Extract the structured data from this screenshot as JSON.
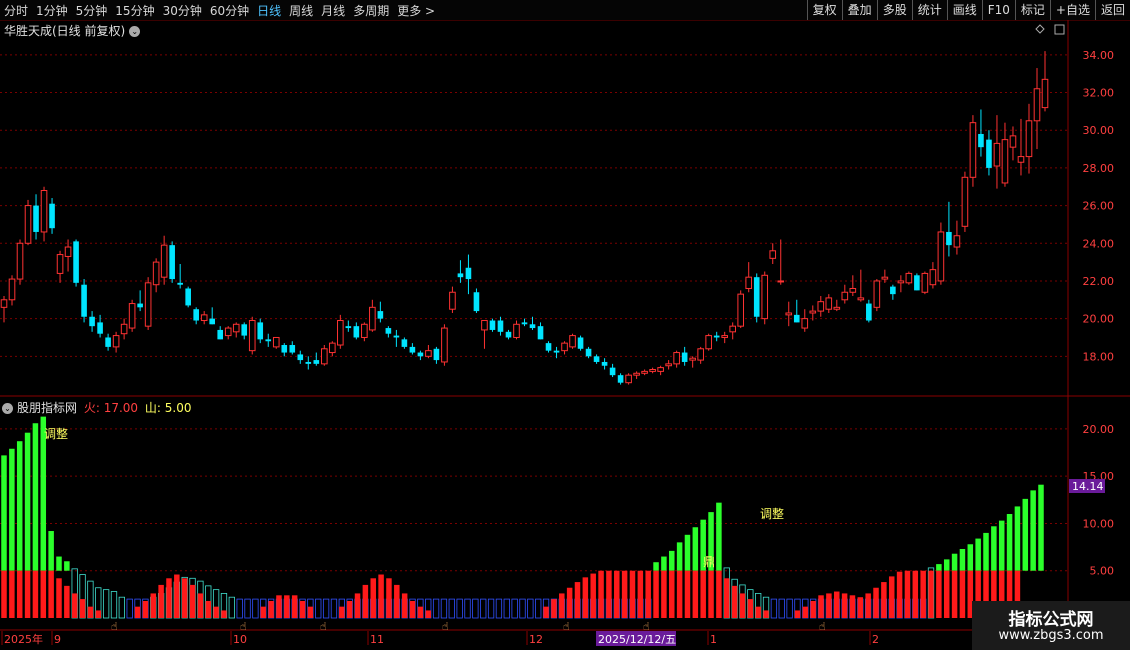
{
  "toolbar": {
    "periods": [
      "分时",
      "1分钟",
      "5分钟",
      "15分钟",
      "30分钟",
      "60分钟",
      "日线",
      "周线",
      "月线",
      "多周期",
      "更多 >"
    ],
    "active_period": "日线",
    "right_buttons": [
      "复权",
      "叠加",
      "多股",
      "统计",
      "画线",
      "F10",
      "标记",
      "+自选",
      "返回"
    ]
  },
  "main_title": "华胜天成(日线 前复权)",
  "indicator": {
    "name": "股朋指标网",
    "fire_label": "火: 17.00",
    "mountain_label": "山: 5.00",
    "current_value": "14.14",
    "annotations": [
      "调整",
      "调整",
      "鼎"
    ]
  },
  "price_axis_labels": [
    "34.00",
    "32.00",
    "30.00",
    "28.00",
    "26.00",
    "24.00",
    "22.00",
    "20.00",
    "18.00"
  ],
  "indicator_axis_labels": [
    "20.00",
    "15.00",
    "10.00",
    "5.00"
  ],
  "date_axis": {
    "labels": [
      "2025年",
      "9",
      "10",
      "11",
      "12",
      "2025/12/12/五",
      "1",
      "2"
    ]
  },
  "colors": {
    "up": "#ff3232",
    "down": "#00e5ff",
    "green_bar": "#2bff2b",
    "red_bar": "#ff1a1a",
    "grid": "#7a0000",
    "axis_text": "#ff4040",
    "highlight": "#6a1b9a"
  },
  "watermark": {
    "line1": "指标公式网",
    "line2": "www.zbgs3.com"
  },
  "chart_data": {
    "type": "candlestick",
    "title": "华胜天成(日线 前复权)",
    "ylim": [
      16.0,
      35.0
    ],
    "candles": [
      [
        20.6,
        21.2,
        19.8,
        21.0
      ],
      [
        21.0,
        22.3,
        20.7,
        22.1
      ],
      [
        22.1,
        24.2,
        21.8,
        24.0
      ],
      [
        24.0,
        26.3,
        23.9,
        26.0
      ],
      [
        26.0,
        26.6,
        24.2,
        24.6
      ],
      [
        24.6,
        27.0,
        24.1,
        26.8
      ],
      [
        26.1,
        26.4,
        24.5,
        24.8
      ],
      [
        22.4,
        23.6,
        21.9,
        23.4
      ],
      [
        23.3,
        24.2,
        22.5,
        23.8
      ],
      [
        24.1,
        24.2,
        21.7,
        21.9
      ],
      [
        21.8,
        22.1,
        19.8,
        20.1
      ],
      [
        20.1,
        20.4,
        19.3,
        19.6
      ],
      [
        19.8,
        20.2,
        19.0,
        19.2
      ],
      [
        19.0,
        19.2,
        18.3,
        18.5
      ],
      [
        18.5,
        19.3,
        18.2,
        19.1
      ],
      [
        19.2,
        20.0,
        18.9,
        19.7
      ],
      [
        19.5,
        21.0,
        19.3,
        20.8
      ],
      [
        20.8,
        21.5,
        20.4,
        20.6
      ],
      [
        19.6,
        22.2,
        19.4,
        21.9
      ],
      [
        21.8,
        23.2,
        21.4,
        23.0
      ],
      [
        22.2,
        24.4,
        21.8,
        23.9
      ],
      [
        23.9,
        24.1,
        21.9,
        22.1
      ],
      [
        21.9,
        22.9,
        21.6,
        21.8
      ],
      [
        21.6,
        21.7,
        20.6,
        20.7
      ],
      [
        20.5,
        20.6,
        19.7,
        19.9
      ],
      [
        19.9,
        20.4,
        19.7,
        20.2
      ],
      [
        20.0,
        20.6,
        19.7,
        19.7
      ],
      [
        19.4,
        19.6,
        18.9,
        18.9
      ],
      [
        19.1,
        19.6,
        18.9,
        19.5
      ],
      [
        19.3,
        19.8,
        19.0,
        19.7
      ],
      [
        19.7,
        19.8,
        18.9,
        19.1
      ],
      [
        18.3,
        20.1,
        18.1,
        19.9
      ],
      [
        19.8,
        20.0,
        18.7,
        18.9
      ],
      [
        18.9,
        19.2,
        18.5,
        18.8
      ],
      [
        18.5,
        19.0,
        18.4,
        19.0
      ],
      [
        18.6,
        18.7,
        18.0,
        18.2
      ],
      [
        18.6,
        18.8,
        18.1,
        18.2
      ],
      [
        18.1,
        18.3,
        17.6,
        17.8
      ],
      [
        17.7,
        18.0,
        17.3,
        17.6
      ],
      [
        17.8,
        18.2,
        17.5,
        17.6
      ],
      [
        17.6,
        18.6,
        17.5,
        18.4
      ],
      [
        18.2,
        18.8,
        18.0,
        18.7
      ],
      [
        18.6,
        20.2,
        18.4,
        19.9
      ],
      [
        19.6,
        19.9,
        19.3,
        19.5
      ],
      [
        19.6,
        19.8,
        18.9,
        19.0
      ],
      [
        19.0,
        19.8,
        18.8,
        19.7
      ],
      [
        19.4,
        21.0,
        19.3,
        20.6
      ],
      [
        20.4,
        20.9,
        19.8,
        20.0
      ],
      [
        19.5,
        19.6,
        19.0,
        19.2
      ],
      [
        19.1,
        19.4,
        18.5,
        19.0
      ],
      [
        18.9,
        19.0,
        18.4,
        18.5
      ],
      [
        18.5,
        18.7,
        18.1,
        18.2
      ],
      [
        18.2,
        18.3,
        17.8,
        18.0
      ],
      [
        18.0,
        18.6,
        17.9,
        18.3
      ],
      [
        18.4,
        18.5,
        17.6,
        17.8
      ],
      [
        17.7,
        19.7,
        17.5,
        19.5
      ],
      [
        20.5,
        21.7,
        20.3,
        21.4
      ],
      [
        22.4,
        23.1,
        21.9,
        22.2
      ],
      [
        22.7,
        23.4,
        21.3,
        22.1
      ],
      [
        21.4,
        21.6,
        20.3,
        20.4
      ],
      [
        19.4,
        19.7,
        18.4,
        19.9
      ],
      [
        19.9,
        20.0,
        19.3,
        19.4
      ],
      [
        19.9,
        20.1,
        19.1,
        19.3
      ],
      [
        19.3,
        19.4,
        18.9,
        19.0
      ],
      [
        19.0,
        19.9,
        18.9,
        19.7
      ],
      [
        19.8,
        20.0,
        19.6,
        19.7
      ],
      [
        19.7,
        20.1,
        19.4,
        19.5
      ],
      [
        19.6,
        19.8,
        18.9,
        18.9
      ],
      [
        18.7,
        18.8,
        18.2,
        18.3
      ],
      [
        18.3,
        18.5,
        17.9,
        18.2
      ],
      [
        18.3,
        18.8,
        18.1,
        18.7
      ],
      [
        18.5,
        19.2,
        18.4,
        19.1
      ],
      [
        19.0,
        19.1,
        18.3,
        18.4
      ],
      [
        18.4,
        18.5,
        17.9,
        18.0
      ],
      [
        18.0,
        18.1,
        17.6,
        17.7
      ],
      [
        17.7,
        17.9,
        17.3,
        17.5
      ],
      [
        17.4,
        17.6,
        16.9,
        17.0
      ],
      [
        17.0,
        17.1,
        16.5,
        16.6
      ],
      [
        16.6,
        17.1,
        16.5,
        17.0
      ],
      [
        17.0,
        17.2,
        16.8,
        17.1
      ],
      [
        17.1,
        17.3,
        17.0,
        17.2
      ],
      [
        17.2,
        17.4,
        17.1,
        17.3
      ],
      [
        17.2,
        17.5,
        17.0,
        17.4
      ],
      [
        17.5,
        17.8,
        17.3,
        17.6
      ],
      [
        17.6,
        18.3,
        17.4,
        18.2
      ],
      [
        18.2,
        18.5,
        17.5,
        17.7
      ],
      [
        17.8,
        18.0,
        17.4,
        17.9
      ],
      [
        17.8,
        18.5,
        17.6,
        18.4
      ],
      [
        18.4,
        19.2,
        18.3,
        19.1
      ],
      [
        19.1,
        19.3,
        18.8,
        19.0
      ],
      [
        19.0,
        19.3,
        18.7,
        19.1
      ],
      [
        19.3,
        19.8,
        18.9,
        19.6
      ],
      [
        19.6,
        21.5,
        19.5,
        21.3
      ],
      [
        21.6,
        23.0,
        21.4,
        22.2
      ],
      [
        22.2,
        22.4,
        19.8,
        20.1
      ],
      [
        20.0,
        22.5,
        19.7,
        22.3
      ],
      [
        23.2,
        24.0,
        22.9,
        23.6
      ],
      [
        22.0,
        24.2,
        21.8,
        22.0
      ],
      [
        20.2,
        20.9,
        19.6,
        20.3
      ],
      [
        20.2,
        21.0,
        19.8,
        19.8
      ],
      [
        19.5,
        20.5,
        19.3,
        20.0
      ],
      [
        20.3,
        20.7,
        19.9,
        20.4
      ],
      [
        20.4,
        21.2,
        20.1,
        20.9
      ],
      [
        20.5,
        21.3,
        20.3,
        21.1
      ],
      [
        20.5,
        21.0,
        20.4,
        20.6
      ],
      [
        21.0,
        21.8,
        20.8,
        21.4
      ],
      [
        21.4,
        22.3,
        21.2,
        21.6
      ],
      [
        21.0,
        22.6,
        20.9,
        21.1
      ],
      [
        20.8,
        21.0,
        19.8,
        19.9
      ],
      [
        20.6,
        22.1,
        20.4,
        22.0
      ],
      [
        22.1,
        22.6,
        21.9,
        22.2
      ],
      [
        21.7,
        21.8,
        21.0,
        21.3
      ],
      [
        21.9,
        22.3,
        21.4,
        22.0
      ],
      [
        21.9,
        22.5,
        21.8,
        22.4
      ],
      [
        22.3,
        22.4,
        21.5,
        21.5
      ],
      [
        21.4,
        22.5,
        21.3,
        22.4
      ],
      [
        21.8,
        23.0,
        21.6,
        22.6
      ],
      [
        22.0,
        25.1,
        21.8,
        24.6
      ],
      [
        24.6,
        26.2,
        23.3,
        23.9
      ],
      [
        23.8,
        25.2,
        23.4,
        24.4
      ],
      [
        24.9,
        27.8,
        24.6,
        27.5
      ],
      [
        27.5,
        30.8,
        27.0,
        30.4
      ],
      [
        29.8,
        31.1,
        28.6,
        29.1
      ],
      [
        29.5,
        30.0,
        27.6,
        28.0
      ],
      [
        28.1,
        30.8,
        26.9,
        29.3
      ],
      [
        27.2,
        30.4,
        27.0,
        29.5
      ],
      [
        29.1,
        30.2,
        28.4,
        29.7
      ],
      [
        28.3,
        30.6,
        27.6,
        28.6
      ],
      [
        28.6,
        31.4,
        27.7,
        30.5
      ],
      [
        30.5,
        33.3,
        29.0,
        32.2
      ],
      [
        31.2,
        34.2,
        31.0,
        32.7
      ]
    ],
    "indicator": {
      "ylim": [
        0,
        22
      ],
      "green_bars": [
        17.2,
        17.9,
        18.7,
        19.6,
        20.6,
        21.3,
        9.2,
        6.5,
        6.0,
        5.2,
        4.6,
        3.9,
        3.2,
        3.0,
        2.8,
        2.2,
        2.0,
        2.0,
        2.0,
        2.2,
        2.6,
        3.2,
        3.8,
        4.3,
        4.2,
        3.9,
        3.4,
        3.0,
        2.6,
        2.2,
        2.0,
        2.0,
        2.0,
        2.0,
        2.0,
        2.0,
        2.0,
        2.0,
        2.0,
        2.0,
        2.0,
        2.0,
        2.0,
        2.0,
        2.0,
        2.0,
        2.0,
        2.0,
        2.0,
        2.0,
        2.0,
        2.0,
        2.0,
        2.0,
        2.0,
        2.0,
        2.0,
        2.0,
        2.0,
        2.0,
        2.0,
        2.0,
        2.0,
        2.0,
        2.0,
        2.0,
        2.0,
        2.0,
        2.0,
        2.0,
        2.0,
        2.0,
        2.0,
        2.0,
        2.0,
        2.0,
        2.0,
        2.0,
        2.0,
        2.0,
        2.0,
        2.0,
        2.0,
        5.9,
        6.5,
        7.1,
        8.0,
        8.8,
        9.6,
        10.4,
        11.2,
        12.2,
        5.3,
        4.1,
        3.5,
        3.0,
        2.6,
        2.2,
        2.0,
        2.0,
        2.0,
        2.0,
        2.0,
        2.0,
        2.0,
        2.0,
        2.0,
        2.0,
        2.0,
        2.0,
        2.0,
        2.0,
        2.0,
        2.0,
        2.0,
        2.0,
        2.0,
        2.0,
        5.3,
        5.7,
        6.2,
        6.8,
        7.3,
        7.8,
        8.4,
        9.0,
        9.7,
        10.3,
        11.0,
        11.8,
        12.6,
        13.5,
        14.1
      ],
      "red_bars": [
        5.0,
        5.0,
        5.0,
        5.0,
        5.0,
        5.0,
        5.0,
        4.2,
        3.4,
        2.6,
        2.0,
        1.2,
        0.8,
        0.5,
        0.5,
        0.5,
        0.5,
        1.2,
        1.8,
        2.6,
        3.5,
        4.2,
        4.6,
        4.2,
        3.5,
        2.6,
        1.8,
        1.2,
        0.8,
        0.5,
        0.5,
        0.5,
        0.5,
        1.2,
        1.8,
        2.4,
        2.4,
        2.4,
        1.8,
        1.2,
        0.5,
        0.5,
        0.5,
        1.2,
        1.8,
        2.6,
        3.5,
        4.2,
        4.6,
        4.2,
        3.5,
        2.6,
        1.8,
        1.2,
        0.8,
        0.5,
        0.5,
        0.5,
        0.5,
        0.5,
        0.5,
        0.5,
        0.5,
        0.5,
        0.5,
        0.5,
        0.5,
        0.5,
        0.5,
        1.2,
        2.0,
        2.6,
        3.2,
        3.8,
        4.3,
        4.7,
        5.0,
        5.0,
        5.0,
        5.0,
        5.0,
        5.0,
        5.0,
        5.0,
        5.0,
        5.0,
        5.0,
        5.0,
        5.0,
        5.0,
        5.0,
        5.0,
        4.2,
        3.4,
        2.6,
        2.0,
        1.2,
        0.8,
        0.5,
        0.5,
        0.5,
        0.8,
        1.2,
        1.8,
        2.4,
        2.6,
        2.8,
        2.6,
        2.4,
        2.2,
        2.6,
        3.2,
        3.8,
        4.4,
        4.9,
        5.0,
        5.0,
        5.0,
        5.0,
        5.0,
        5.0,
        5.0,
        5.0,
        5.0,
        5.0,
        5.0,
        5.0,
        5.0,
        5.0,
        5.0
      ]
    }
  }
}
